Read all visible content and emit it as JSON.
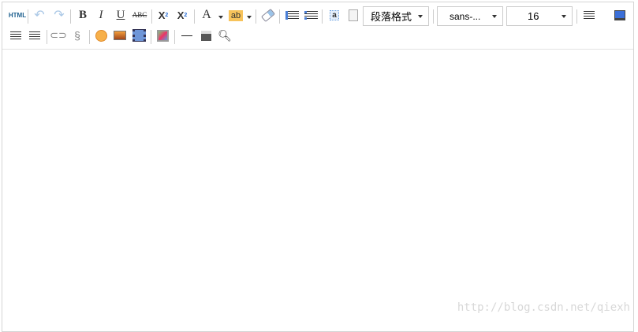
{
  "toolbar": {
    "html_label": "HTML",
    "bold": "B",
    "italic": "I",
    "underline": "U",
    "strike": "ABC",
    "sup": "X",
    "sup_mark": "2",
    "sub": "X",
    "sub_mark": "2",
    "fontcolor": "A",
    "highlight": "ab",
    "paragraph": {
      "value": "段落格式"
    },
    "fontfamily": {
      "value": "sans-..."
    },
    "fontsize": {
      "value": "16"
    }
  },
  "watermark": "http://blog.csdn.net/qiexh"
}
